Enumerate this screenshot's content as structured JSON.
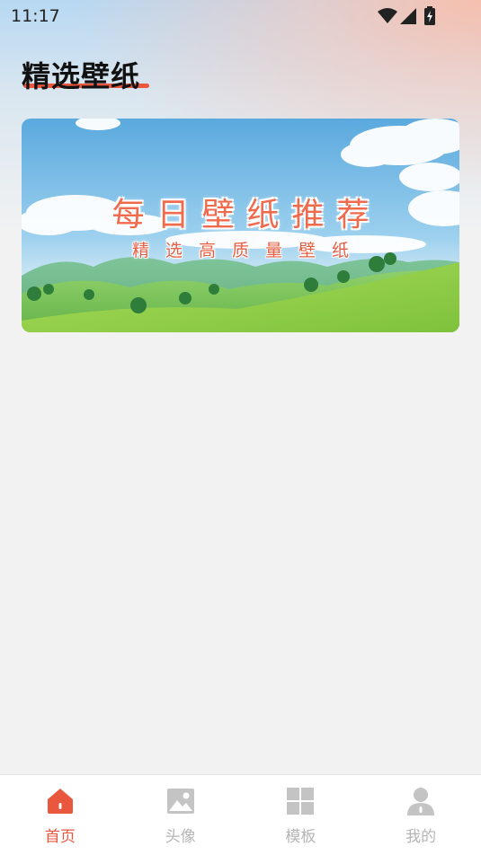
{
  "status_bar": {
    "time": "11:17",
    "icons": [
      "wifi-icon",
      "cellular-signal-icon",
      "battery-charging-icon"
    ]
  },
  "header": {
    "title": "精选壁纸"
  },
  "banner": {
    "title": "每日壁纸推荐",
    "subtitle": "精选高质量壁纸"
  },
  "bottom_nav": {
    "items": [
      {
        "label": "首页",
        "icon": "home-icon",
        "active": true
      },
      {
        "label": "头像",
        "icon": "image-icon",
        "active": false
      },
      {
        "label": "模板",
        "icon": "grid-icon",
        "active": false
      },
      {
        "label": "我的",
        "icon": "user-icon",
        "active": false
      }
    ]
  },
  "colors": {
    "accent": "#e8573e",
    "inactive": "#b5b5b5",
    "background": "#f2f2f2"
  }
}
